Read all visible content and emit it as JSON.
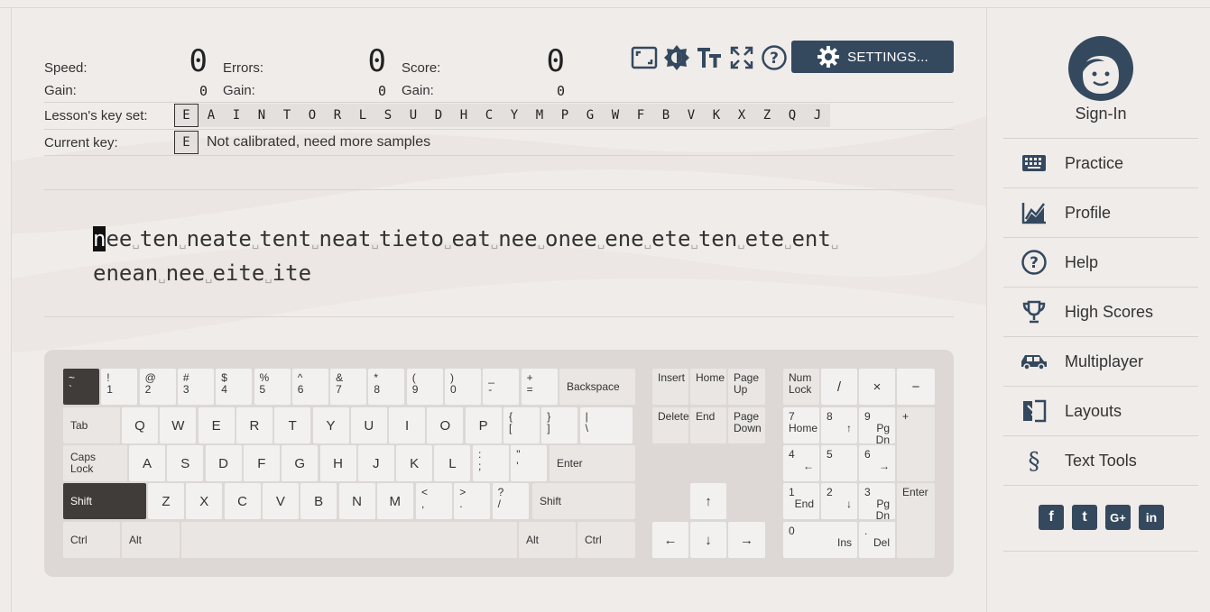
{
  "stats": {
    "speed_label": "Speed:",
    "speed": "0",
    "speed_gain_label": "Gain:",
    "speed_gain": "0",
    "errors_label": "Errors:",
    "errors": "0",
    "errors_gain_label": "Gain:",
    "errors_gain": "0",
    "score_label": "Score:",
    "score": "0",
    "score_gain_label": "Gain:",
    "score_gain": "0"
  },
  "toolbar": {
    "icons": [
      "zoom-screen-icon",
      "theme-brightness-icon",
      "font-size-icon",
      "fullscreen-icon",
      "help-icon"
    ],
    "settings_label": "SETTINGS..."
  },
  "lesson": {
    "keyset_label": "Lesson's key set:",
    "keys": [
      "E",
      "A",
      "I",
      "N",
      "T",
      "O",
      "R",
      "L",
      "S",
      "U",
      "D",
      "H",
      "C",
      "Y",
      "M",
      "P",
      "G",
      "W",
      "F",
      "B",
      "V",
      "K",
      "X",
      "Z",
      "Q",
      "J"
    ],
    "current_label": "Current key:",
    "current_key": "E",
    "current_text": "Not calibrated, need more samples"
  },
  "text": {
    "cursor_char": "n",
    "words_line1": [
      "ee",
      "ten",
      "neate",
      "tent",
      "neat",
      "tieto",
      "eat",
      "nee",
      "onee",
      "ene",
      "ete",
      "ten",
      "ete",
      "ent"
    ],
    "words_line2": [
      "enean",
      "nee",
      "eite",
      "ite"
    ]
  },
  "keyboard": {
    "row1": [
      [
        "~",
        "`"
      ],
      [
        "!",
        "1"
      ],
      [
        "@",
        "2"
      ],
      [
        "#",
        "3"
      ],
      [
        "$",
        "4"
      ],
      [
        "%",
        "5"
      ],
      [
        "^",
        "6"
      ],
      [
        "&",
        "7"
      ],
      [
        "*",
        "8"
      ],
      [
        "(",
        "9"
      ],
      [
        ")",
        "0"
      ],
      [
        "_",
        "-"
      ],
      [
        "+",
        "="
      ]
    ],
    "backspace": "Backspace",
    "tab": "Tab",
    "row2": [
      "Q",
      "W",
      "E",
      "R",
      "T",
      "Y",
      "U",
      "I",
      "O",
      "P"
    ],
    "row2_sym": [
      [
        "{",
        "["
      ],
      [
        "}",
        "]"
      ],
      [
        "|",
        "\\"
      ]
    ],
    "caps": "Caps Lock",
    "row3": [
      "A",
      "S",
      "D",
      "F",
      "G",
      "H",
      "J",
      "K",
      "L"
    ],
    "row3_sym": [
      [
        ":",
        ";"
      ],
      [
        "\"",
        "'"
      ]
    ],
    "enter": "Enter",
    "shift": "Shift",
    "row4": [
      "Z",
      "X",
      "C",
      "V",
      "B",
      "N",
      "M"
    ],
    "row4_sym": [
      [
        "<",
        ","
      ],
      [
        ">",
        "."
      ],
      [
        "?",
        "/"
      ]
    ],
    "ctrl": "Ctrl",
    "alt": "Alt",
    "nav": {
      "insert": "Insert",
      "home": "Home",
      "page_up": "Page Up",
      "delete": "Delete",
      "end": "End",
      "page_down": "Page Down",
      "up": "↑",
      "left": "←",
      "down": "↓",
      "right": "→"
    },
    "numpad": {
      "num_lock": "Num Lock",
      "divide": "/",
      "multiply": "×",
      "minus": "−",
      "plus": "+",
      "enter": "Enter",
      "n7": [
        "7",
        "Home"
      ],
      "n8": [
        "8",
        "↑"
      ],
      "n9": [
        "9",
        "Pg Dn"
      ],
      "n4": [
        "4",
        "←"
      ],
      "n5": [
        "5",
        ""
      ],
      "n6": [
        "6",
        "→"
      ],
      "n1": [
        "1",
        "End"
      ],
      "n2": [
        "2",
        "↓"
      ],
      "n3": [
        "3",
        "Pg Dn"
      ],
      "n0": [
        "0",
        "Ins"
      ],
      "dot": [
        ".",
        "Del"
      ]
    }
  },
  "sidebar": {
    "signin": "Sign-In",
    "items": [
      {
        "label": "Practice",
        "icon": "keyboard-icon"
      },
      {
        "label": "Profile",
        "icon": "chart-icon"
      },
      {
        "label": "Help",
        "icon": "help-circle-icon"
      },
      {
        "label": "High Scores",
        "icon": "trophy-icon"
      },
      {
        "label": "Multiplayer",
        "icon": "car-icon"
      },
      {
        "label": "Layouts",
        "icon": "layouts-icon"
      },
      {
        "label": "Text Tools",
        "icon": "section-icon"
      }
    ],
    "social": [
      "f",
      "t",
      "G+",
      "in"
    ]
  },
  "colors": {
    "accent": "#34495e",
    "background": "#f0ecea",
    "key_dark": "#3f3c3a"
  }
}
